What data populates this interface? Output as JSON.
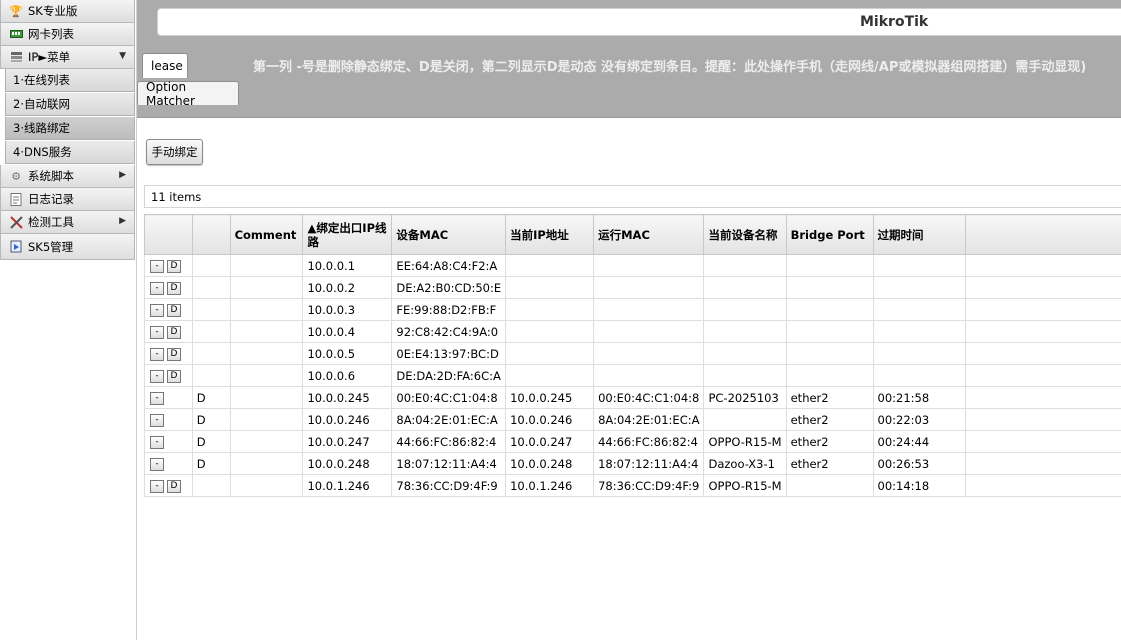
{
  "sidebar": {
    "items": [
      {
        "label": "SK专业版",
        "icon": "trophy-icon"
      },
      {
        "label": "网卡列表",
        "icon": "network-card-icon"
      },
      {
        "label": "IP►菜单",
        "icon": "ip-icon"
      },
      {
        "label": "系统脚本",
        "icon": "gear-icon"
      },
      {
        "label": "日志记录",
        "icon": "log-icon"
      },
      {
        "label": "检测工具",
        "icon": "tools-icon"
      },
      {
        "label": "SK5管理",
        "icon": "sk5-icon"
      }
    ],
    "subitems": [
      "1·在线列表",
      "2·自动联网",
      "3·线路绑定",
      "4·DNS服务"
    ]
  },
  "header": {
    "title": "MikroTik",
    "tabs": [
      "lease",
      "Option Matcher"
    ],
    "hint": "第一列 -号是删除静态绑定、D是关闭，第二列显示D是动态 没有绑定到条目。提醒：此处操作手机（走网线/AP或模拟器组网搭建）需手动显现)"
  },
  "toolbar": {
    "manual_bind": "手动绑定"
  },
  "count": "11 items",
  "table": {
    "headers": [
      "",
      "",
      "Comment",
      "▲绑定出口IP线路",
      "设备MAC",
      "当前IP地址",
      "运行MAC",
      "当前设备名称",
      "Bridge Port",
      "过期时间",
      ""
    ],
    "rows": [
      {
        "btns": [
          "-",
          "D"
        ],
        "flag": "",
        "comment": "",
        "ip": "10.0.0.1",
        "mac": "EE:64:A8:C4:F2:A",
        "cur_ip": "",
        "run_mac": "",
        "dev": "",
        "port": "",
        "exp": ""
      },
      {
        "btns": [
          "-",
          "D"
        ],
        "flag": "",
        "comment": "",
        "ip": "10.0.0.2",
        "mac": "DE:A2:B0:CD:50:E",
        "cur_ip": "",
        "run_mac": "",
        "dev": "",
        "port": "",
        "exp": ""
      },
      {
        "btns": [
          "-",
          "D"
        ],
        "flag": "",
        "comment": "",
        "ip": "10.0.0.3",
        "mac": "FE:99:88:D2:FB:F",
        "cur_ip": "",
        "run_mac": "",
        "dev": "",
        "port": "",
        "exp": ""
      },
      {
        "btns": [
          "-",
          "D"
        ],
        "flag": "",
        "comment": "",
        "ip": "10.0.0.4",
        "mac": "92:C8:42:C4:9A:0",
        "cur_ip": "",
        "run_mac": "",
        "dev": "",
        "port": "",
        "exp": ""
      },
      {
        "btns": [
          "-",
          "D"
        ],
        "flag": "",
        "comment": "",
        "ip": "10.0.0.5",
        "mac": "0E:E4:13:97:BC:D",
        "cur_ip": "",
        "run_mac": "",
        "dev": "",
        "port": "",
        "exp": ""
      },
      {
        "btns": [
          "-",
          "D"
        ],
        "flag": "",
        "comment": "",
        "ip": "10.0.0.6",
        "mac": "DE:DA:2D:FA:6C:A",
        "cur_ip": "",
        "run_mac": "",
        "dev": "",
        "port": "",
        "exp": ""
      },
      {
        "btns": [
          "-"
        ],
        "flag": "D",
        "comment": "",
        "ip": "10.0.0.245",
        "mac": "00:E0:4C:C1:04:8",
        "cur_ip": "10.0.0.245",
        "run_mac": "00:E0:4C:C1:04:8",
        "dev": "PC-2025103",
        "port": "ether2",
        "exp": "00:21:58"
      },
      {
        "btns": [
          "-"
        ],
        "flag": "D",
        "comment": "",
        "ip": "10.0.0.246",
        "mac": "8A:04:2E:01:EC:A",
        "cur_ip": "10.0.0.246",
        "run_mac": "8A:04:2E:01:EC:A",
        "dev": "",
        "port": "ether2",
        "exp": "00:22:03"
      },
      {
        "btns": [
          "-"
        ],
        "flag": "D",
        "comment": "",
        "ip": "10.0.0.247",
        "mac": "44:66:FC:86:82:4",
        "cur_ip": "10.0.0.247",
        "run_mac": "44:66:FC:86:82:4",
        "dev": "OPPO-R15-M",
        "port": "ether2",
        "exp": "00:24:44"
      },
      {
        "btns": [
          "-"
        ],
        "flag": "D",
        "comment": "",
        "ip": "10.0.0.248",
        "mac": "18:07:12:11:A4:4",
        "cur_ip": "10.0.0.248",
        "run_mac": "18:07:12:11:A4:4",
        "dev": "Dazoo-X3-1",
        "port": "ether2",
        "exp": "00:26:53"
      },
      {
        "btns": [
          "-",
          "D"
        ],
        "flag": "",
        "comment": "",
        "ip": "10.0.1.246",
        "mac": "78:36:CC:D9:4F:9",
        "cur_ip": "10.0.1.246",
        "run_mac": "78:36:CC:D9:4F:9",
        "dev": "OPPO-R15-M",
        "port": "",
        "exp": "00:14:18"
      }
    ]
  }
}
